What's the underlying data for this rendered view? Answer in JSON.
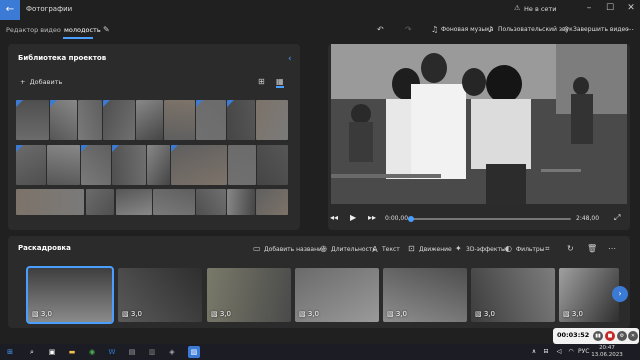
{
  "titlebar": {
    "app_title": "Фотографии",
    "network_status": "Не в сети"
  },
  "toolbar": {
    "editor_label": "Редактор видео",
    "project_name": "молодость",
    "actions": {
      "music": "Фоновая музыка",
      "custom_audio": "Пользовательский звук",
      "finish": "Завершить видео"
    }
  },
  "library": {
    "title": "Библиотека проектов",
    "add_label": "Добавить"
  },
  "player": {
    "current_time": "0:00,00",
    "total_time": "2:48,00",
    "progress": 0
  },
  "storyboard": {
    "title": "Раскадровка",
    "actions": {
      "add_title": "Добавить название",
      "duration": "Длительность",
      "text": "Текст",
      "motion": "Движение",
      "effects_3d": "3D-эффекты",
      "filters": "Фильтры"
    },
    "clips": [
      {
        "duration": "3,0"
      },
      {
        "duration": "3,0"
      },
      {
        "duration": "3,0"
      },
      {
        "duration": "3,0"
      },
      {
        "duration": "3,0"
      },
      {
        "duration": "3,0"
      },
      {
        "duration": "3,0"
      },
      {
        "duration": "3,0"
      }
    ]
  },
  "recorder": {
    "time": "00:03:52"
  },
  "taskbar": {
    "language": "РУС",
    "time": "20:47",
    "date": "13.06.2023"
  }
}
